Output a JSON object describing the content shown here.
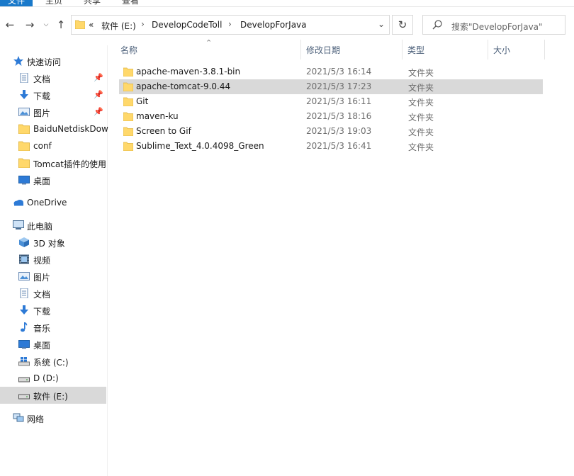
{
  "ribbon": {
    "tabs": [
      "文件",
      "主页",
      "共享",
      "查看"
    ]
  },
  "address": {
    "overflow": "«",
    "crumbs": [
      "软件 (E:)",
      "DevelopCodeToll",
      "DevelopForJava"
    ]
  },
  "search": {
    "placeholder": "搜索\"DevelopForJava\""
  },
  "sidebar": {
    "quick_access": "快速访问",
    "quick_items": [
      "文档",
      "下载",
      "图片",
      "BaiduNetdiskDow",
      "conf",
      "Tomcat插件的使用",
      "桌面"
    ],
    "onedrive": "OneDrive",
    "this_pc": "此电脑",
    "pc_items": [
      "3D 对象",
      "视频",
      "图片",
      "文档",
      "下载",
      "音乐",
      "桌面",
      "系统 (C:)",
      "D (D:)",
      "软件 (E:)"
    ],
    "network": "网络"
  },
  "columns": {
    "name": "名称",
    "date": "修改日期",
    "type": "类型",
    "size": "大小"
  },
  "files": [
    {
      "name": "apache-maven-3.8.1-bin",
      "date": "2021/5/3 16:14",
      "type": "文件夹"
    },
    {
      "name": "apache-tomcat-9.0.44",
      "date": "2021/5/3 17:23",
      "type": "文件夹"
    },
    {
      "name": "Git",
      "date": "2021/5/3 16:11",
      "type": "文件夹"
    },
    {
      "name": "maven-ku",
      "date": "2021/5/3 18:16",
      "type": "文件夹"
    },
    {
      "name": "Screen to Gif",
      "date": "2021/5/3 19:03",
      "type": "文件夹"
    },
    {
      "name": "Sublime_Text_4.0.4098_Green",
      "date": "2021/5/3 16:41",
      "type": "文件夹"
    }
  ],
  "colors": {
    "accent": "#1979ca",
    "folder": "#ffd86b",
    "selection": "#d9d9d9"
  }
}
